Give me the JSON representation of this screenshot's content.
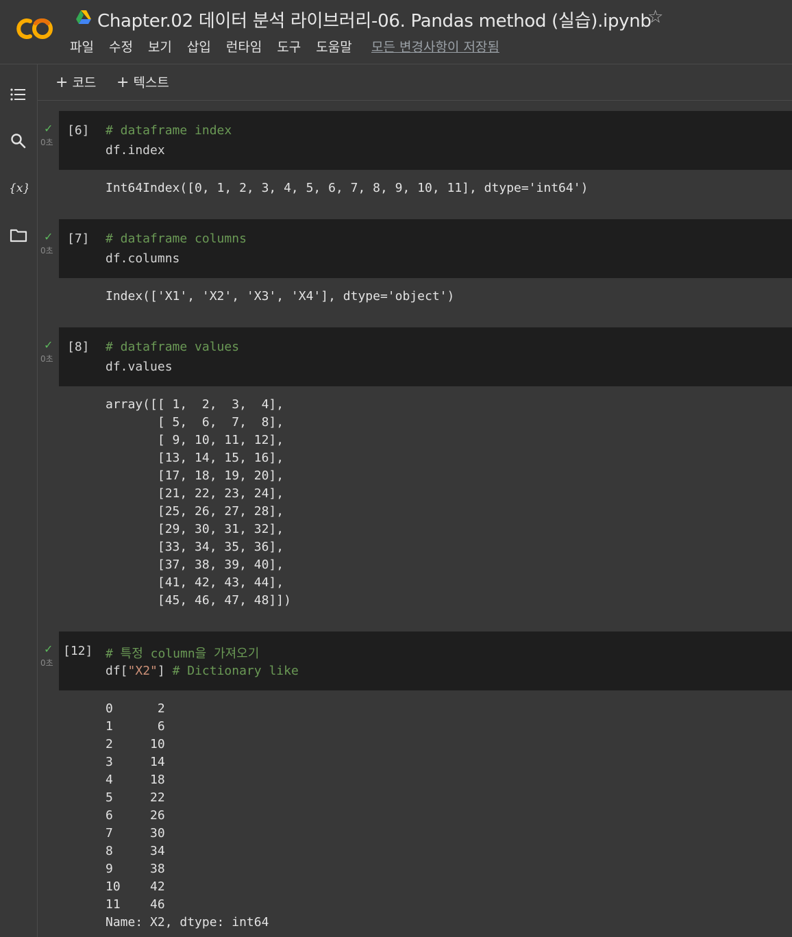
{
  "header": {
    "title": "Chapter.02 데이터 분석 라이브러리-06. Pandas method (실습).ipynb",
    "star": "☆",
    "menu": [
      "파일",
      "수정",
      "보기",
      "삽입",
      "런타임",
      "도구",
      "도움말"
    ],
    "saved_status": "모든 변경사항이 저장됨"
  },
  "toolbar": {
    "add_code": "코드",
    "add_text": "텍스트"
  },
  "cells": [
    {
      "exec": "[6]",
      "status": "✓",
      "duration": "0초",
      "comment": "# dataframe index",
      "code": "df.index",
      "output": [
        "Int64Index([0, 1, 2, 3, 4, 5, 6, 7, 8, 9, 10, 11], dtype='int64')"
      ]
    },
    {
      "exec": "[7]",
      "status": "✓",
      "duration": "0초",
      "comment": "# dataframe columns",
      "code": "df.columns",
      "output": [
        "Index(['X1', 'X2', 'X3', 'X4'], dtype='object')"
      ]
    },
    {
      "exec": "[8]",
      "status": "✓",
      "duration": "0초",
      "comment": "# dataframe values",
      "code": "df.values",
      "output": [
        "array([[ 1,  2,  3,  4],",
        "       [ 5,  6,  7,  8],",
        "       [ 9, 10, 11, 12],",
        "       [13, 14, 15, 16],",
        "       [17, 18, 19, 20],",
        "       [21, 22, 23, 24],",
        "       [25, 26, 27, 28],",
        "       [29, 30, 31, 32],",
        "       [33, 34, 35, 36],",
        "       [37, 38, 39, 40],",
        "       [41, 42, 43, 44],",
        "       [45, 46, 47, 48]])"
      ]
    },
    {
      "exec": "[12]",
      "status": "✓",
      "duration": "0초",
      "comment": "# 특정 column을 가져오기",
      "code_prefix": "df[",
      "code_string": "\"X2\"",
      "code_suffix": "] ",
      "code_comment": "# Dictionary like",
      "output": [
        "0      2",
        "1      6",
        "2     10",
        "3     14",
        "4     18",
        "5     22",
        "6     26",
        "7     30",
        "8     34",
        "9     38",
        "10    42",
        "11    46",
        "Name: X2, dtype: int64"
      ]
    }
  ],
  "colors": {
    "background": "#383838",
    "code_bg": "#1e1e1e",
    "comment": "#6a9955",
    "string": "#ce9178",
    "check": "#5cb85c"
  }
}
